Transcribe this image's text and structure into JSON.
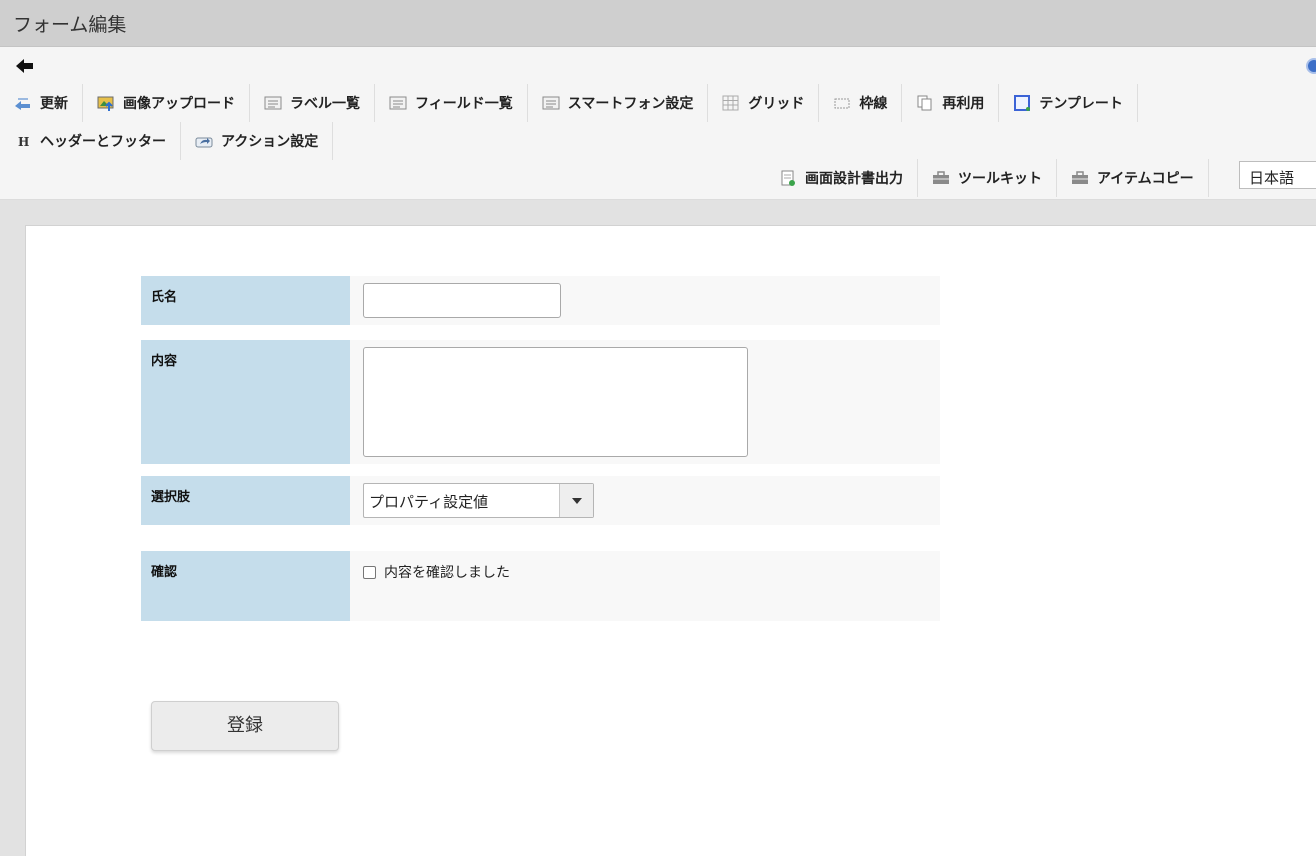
{
  "window": {
    "title": "フォーム編集"
  },
  "toolbar": {
    "row1": [
      {
        "label": "更新",
        "icon": "update-icon"
      },
      {
        "label": "画像アップロード",
        "icon": "image-upload-icon"
      },
      {
        "label": "ラベル一覧",
        "icon": "label-list-icon"
      },
      {
        "label": "フィールド一覧",
        "icon": "field-list-icon"
      },
      {
        "label": "スマートフォン設定",
        "icon": "smartphone-settings-icon"
      },
      {
        "label": "グリッド",
        "icon": "grid-icon"
      },
      {
        "label": "枠線",
        "icon": "border-icon"
      },
      {
        "label": "再利用",
        "icon": "reuse-icon"
      },
      {
        "label": "テンプレート",
        "icon": "template-icon"
      }
    ],
    "row2": [
      {
        "label": "ヘッダーとフッター",
        "icon": "header-footer-icon"
      },
      {
        "label": "アクション設定",
        "icon": "action-settings-icon"
      }
    ],
    "row3": [
      {
        "label": "画面設計書出力",
        "icon": "spec-export-icon"
      },
      {
        "label": "ツールキット",
        "icon": "toolkit-icon"
      },
      {
        "label": "アイテムコピー",
        "icon": "item-copy-icon"
      }
    ],
    "language": "日本語"
  },
  "form": {
    "name_label": "氏名",
    "content_label": "内容",
    "choice_label": "選択肢",
    "choice_value": "プロパティ設定値",
    "confirm_label": "確認",
    "confirm_checkbox_label": "内容を確認しました",
    "submit_label": "登録"
  }
}
